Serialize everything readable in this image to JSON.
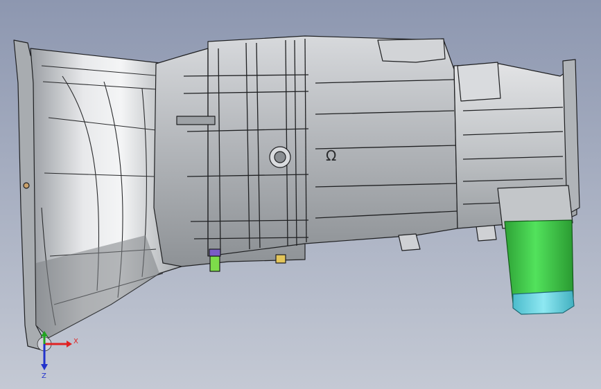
{
  "viewport": {
    "background_top": "#8d97b0",
    "background_bottom": "#c4c9d4",
    "model": "transmission-assembly"
  },
  "model": {
    "body_color": "#b9bcc0",
    "body_light": "#e9eaec",
    "body_dark": "#6e7276",
    "edge_color": "#1e1f21",
    "motor_green": "#3fd34a",
    "motor_green_dark": "#1f8f27",
    "motor_cyan": "#5fd6e6",
    "bolt_green": "#7ddc4a",
    "bolt_purple": "#7a5cc8",
    "bolt_yellow": "#e3c55a",
    "logo_symbol": "Ω"
  },
  "triad": {
    "x_label": "X",
    "y_label": "Y",
    "z_label": "Z",
    "x_color": "#e02222",
    "y_color": "#22a322",
    "z_color": "#2233cc"
  }
}
